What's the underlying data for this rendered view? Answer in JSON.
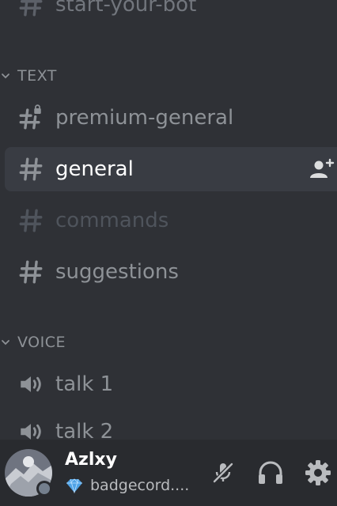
{
  "channels_top": [
    {
      "label": "start-your-bot"
    }
  ],
  "categories": {
    "text": "TEXT",
    "voice": "VOICE"
  },
  "text_channels": [
    {
      "label": "premium-general",
      "locked": true
    },
    {
      "label": "general",
      "selected": true
    },
    {
      "label": "commands",
      "muted": true
    },
    {
      "label": "suggestions"
    }
  ],
  "voice_channels": [
    {
      "label": "talk 1"
    },
    {
      "label": "talk 2"
    }
  ],
  "icons": {
    "hash": "hash-icon",
    "locked_hash": "locked-hash-icon",
    "speaker": "speaker-icon",
    "invite": "invite-member-icon",
    "mic_muted": "microphone-muted-icon",
    "headphones": "headphones-icon",
    "settings": "gear-icon",
    "status_emoji": "diamond-icon"
  },
  "user": {
    "name": "Azlxy",
    "status": "badgecord...."
  },
  "colors": {
    "sidebar_bg": "#2f3136",
    "panel_bg": "#292b2f",
    "selected_bg": "#393c43",
    "text_muted": "#8e9297",
    "text_white": "#ffffff",
    "status_offline": "#747f8d",
    "gem_blue": "#4fa3e6"
  }
}
